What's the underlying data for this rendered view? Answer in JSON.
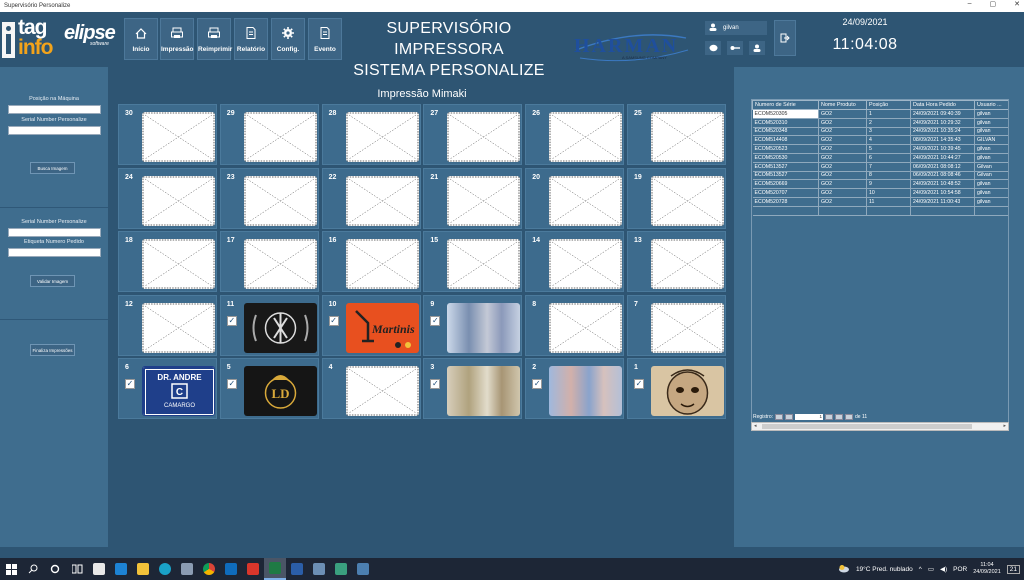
{
  "window": {
    "title": "Supervisório Personalize",
    "minimize": "–",
    "maximize": "▢",
    "close": "✕"
  },
  "header": {
    "logo_tag": "tag",
    "logo_info": "info",
    "logo_elipse": "elipse",
    "logo_elipse_sub": "software",
    "toolbar": [
      {
        "label": "Início",
        "icon": "home-icon"
      },
      {
        "label": "Impressão",
        "icon": "printer-icon"
      },
      {
        "label": "Reimprimir",
        "icon": "printer-icon"
      },
      {
        "label": "Relatório",
        "icon": "document-icon"
      },
      {
        "label": "Config.",
        "icon": "gear-icon"
      },
      {
        "label": "Evento",
        "icon": "document-icon"
      }
    ],
    "title_line1": "SUPERVISÓRIO IMPRESSORA",
    "title_line2": "SISTEMA PERSONALIZE",
    "brand": "HARMAN",
    "brand_sub": "A SAMSUNG COMPANY",
    "user": "gilvan",
    "date": "24/09/2021",
    "time": "11:04:08"
  },
  "left_panel": {
    "position_label": "Posição na Máquina",
    "serial_label": "Serial Number Personalize",
    "search_button": "Busca Imagem",
    "serial_label2": "Serial Number Personalize",
    "order_label": "Etiqueta Numero Pedido",
    "validate_button": "Validar Imagem",
    "finish_button": "Finaliza Impressões"
  },
  "center": {
    "title": "Impressão Mimaki",
    "slots": [
      {
        "n": "30",
        "checked": false,
        "img": "placeholder"
      },
      {
        "n": "29",
        "checked": false,
        "img": "placeholder"
      },
      {
        "n": "28",
        "checked": false,
        "img": "placeholder"
      },
      {
        "n": "27",
        "checked": false,
        "img": "placeholder"
      },
      {
        "n": "26",
        "checked": false,
        "img": "placeholder"
      },
      {
        "n": "25",
        "checked": false,
        "img": "placeholder"
      },
      {
        "n": "24",
        "checked": false,
        "img": "placeholder"
      },
      {
        "n": "23",
        "checked": false,
        "img": "placeholder"
      },
      {
        "n": "22",
        "checked": false,
        "img": "placeholder"
      },
      {
        "n": "21",
        "checked": false,
        "img": "placeholder"
      },
      {
        "n": "20",
        "checked": false,
        "img": "placeholder"
      },
      {
        "n": "19",
        "checked": false,
        "img": "placeholder"
      },
      {
        "n": "18",
        "checked": false,
        "img": "placeholder"
      },
      {
        "n": "17",
        "checked": false,
        "img": "placeholder"
      },
      {
        "n": "16",
        "checked": false,
        "img": "placeholder"
      },
      {
        "n": "15",
        "checked": false,
        "img": "placeholder"
      },
      {
        "n": "14",
        "checked": false,
        "img": "placeholder"
      },
      {
        "n": "13",
        "checked": false,
        "img": "placeholder"
      },
      {
        "n": "12",
        "checked": false,
        "img": "placeholder"
      },
      {
        "n": "11",
        "checked": true,
        "img": "chi"
      },
      {
        "n": "10",
        "checked": true,
        "img": "mart",
        "text": "Martinis"
      },
      {
        "n": "9",
        "checked": true,
        "img": "blur1"
      },
      {
        "n": "8",
        "checked": false,
        "img": "placeholder"
      },
      {
        "n": "7",
        "checked": false,
        "img": "placeholder"
      },
      {
        "n": "6",
        "checked": true,
        "img": "dr",
        "text": "DR. ANDRE",
        "text2": "CAMARGO"
      },
      {
        "n": "5",
        "checked": true,
        "img": "ld"
      },
      {
        "n": "4",
        "checked": false,
        "img": "placeholder"
      },
      {
        "n": "3",
        "checked": true,
        "img": "blur2"
      },
      {
        "n": "2",
        "checked": true,
        "img": "blur3"
      },
      {
        "n": "1",
        "checked": true,
        "img": "mask"
      }
    ]
  },
  "table": {
    "columns": [
      "Numero de Série",
      "Nome Produto",
      "Posição",
      "Data Hora Pedido",
      "Usuario ..."
    ],
    "rows": [
      [
        "ECOM520305",
        "GO2",
        "1",
        "24/09/2021 09:40:39",
        "gilvan"
      ],
      [
        "ECOM520310",
        "GO2",
        "2",
        "24/09/2021 10:29:32",
        "gilvan"
      ],
      [
        "ECOM520348",
        "GO2",
        "3",
        "24/09/2021 10:35:24",
        "gilvan"
      ],
      [
        "ECOM514408",
        "GO2",
        "4",
        "08/09/2021 14:35:43",
        "GILVAN"
      ],
      [
        "ECOM520523",
        "GO2",
        "5",
        "24/09/2021 10:39:45",
        "gilvan"
      ],
      [
        "ECOM520530",
        "GO2",
        "6",
        "24/09/2021 10:44:27",
        "gilvan"
      ],
      [
        "ECOM513527",
        "GO2",
        "7",
        "06/09/2021 08:08:12",
        "Gilvan"
      ],
      [
        "ECOM513527",
        "GO2",
        "8",
        "06/09/2021 08:08:46",
        "Gilvan"
      ],
      [
        "ECOM520669",
        "GO2",
        "9",
        "24/09/2021 10:48:52",
        "gilvan"
      ],
      [
        "ECOM520707",
        "GO2",
        "10",
        "24/09/2021 10:54:58",
        "gilvan"
      ],
      [
        "ECOM520728",
        "GO2",
        "11",
        "24/09/2021 11:00:43",
        "gilvan"
      ]
    ],
    "pager_label": "Registro:",
    "pager_value": "1",
    "pager_total": "de 11"
  },
  "taskbar": {
    "weather": "19°C  Pred. nublado",
    "lang": "POR",
    "clock_time": "11:04",
    "clock_date": "24/09/2021",
    "notif": "21"
  }
}
